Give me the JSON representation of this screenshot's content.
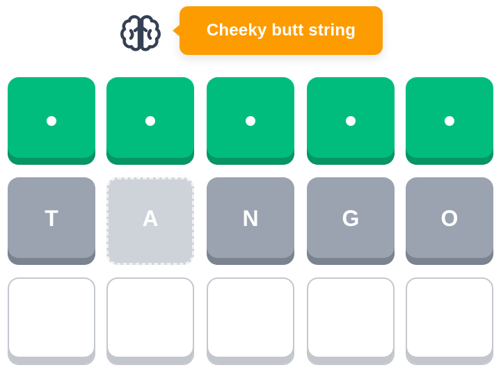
{
  "hint": {
    "icon": "brain-icon",
    "text": "Cheeky butt string",
    "bubble_color": "#fd9c00"
  },
  "colors": {
    "correct": "#00bd7e",
    "filled": "#9aa3af",
    "revealed": "#ced3da",
    "empty_border": "#c3c8cf"
  },
  "board": {
    "rows": [
      {
        "tiles": [
          {
            "state": "correct",
            "letter": ""
          },
          {
            "state": "correct",
            "letter": ""
          },
          {
            "state": "correct",
            "letter": ""
          },
          {
            "state": "correct",
            "letter": ""
          },
          {
            "state": "correct",
            "letter": ""
          }
        ]
      },
      {
        "tiles": [
          {
            "state": "filled",
            "letter": "T"
          },
          {
            "state": "revealed",
            "letter": "A"
          },
          {
            "state": "filled",
            "letter": "N"
          },
          {
            "state": "filled",
            "letter": "G"
          },
          {
            "state": "filled",
            "letter": "O"
          }
        ]
      },
      {
        "tiles": [
          {
            "state": "empty",
            "letter": ""
          },
          {
            "state": "empty",
            "letter": ""
          },
          {
            "state": "empty",
            "letter": ""
          },
          {
            "state": "empty",
            "letter": ""
          },
          {
            "state": "empty",
            "letter": ""
          }
        ]
      }
    ]
  }
}
